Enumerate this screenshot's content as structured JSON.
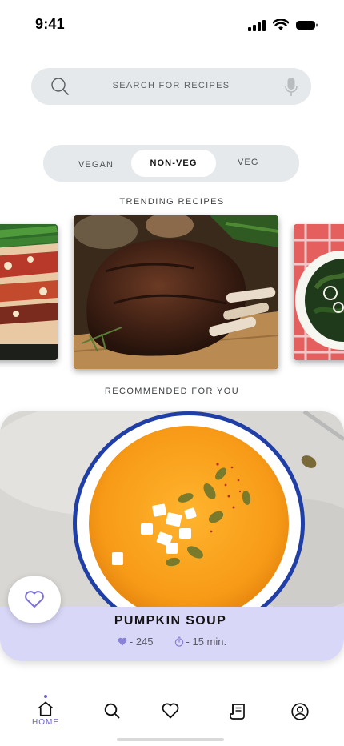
{
  "status_bar": {
    "time": "9:41"
  },
  "search": {
    "placeholder": "SEARCH FOR RECIPES"
  },
  "segments": [
    {
      "label": "VEGAN",
      "selected": false
    },
    {
      "label": "NON-VEG",
      "selected": true
    },
    {
      "label": "VEG",
      "selected": false
    }
  ],
  "trending": {
    "title": "TRENDING RECIPES"
  },
  "recommended": {
    "title": "RECOMMENDED FOR YOU",
    "card": {
      "name": "PUMPKIN SOUP",
      "likes": "- 245",
      "time": "- 15 min."
    }
  },
  "nav": {
    "items": [
      {
        "label": "HOME",
        "icon": "home-icon",
        "active": true
      },
      {
        "icon": "search-icon",
        "active": false
      },
      {
        "icon": "heart-icon",
        "active": false
      },
      {
        "icon": "recipe-book-icon",
        "active": false
      },
      {
        "icon": "profile-icon",
        "active": false
      }
    ]
  },
  "colors": {
    "accent": "#6b63c9",
    "pill_bg": "#e5e9ec",
    "card_info_bg": "#d9d7f7"
  }
}
